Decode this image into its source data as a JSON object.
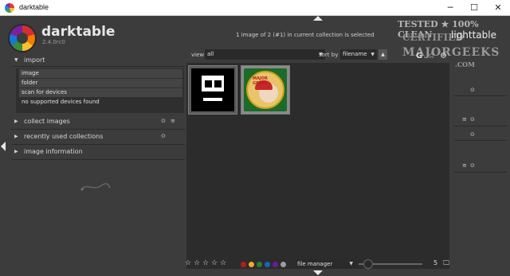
{
  "window": {
    "title": "darktable"
  },
  "header": {
    "app_name": "darktable",
    "version": "2.4.0rc0",
    "status_message": "1 image of 2 (#1) in current collection is selected",
    "view_label": "lighttable",
    "icons": [
      "G",
      "star-icon",
      "gear-icon"
    ]
  },
  "watermark": {
    "line1": "TESTED ★ 100% CLEAN",
    "line2": "CERTIFIED",
    "line3": "MAJORGEEKS",
    "line4": ".COM",
    "stars": "★★★★★"
  },
  "left_panel": {
    "import": {
      "title": "import",
      "items": [
        "image",
        "folder",
        "scan for devices",
        "no supported devices found"
      ]
    },
    "modules": [
      {
        "title": "collect images"
      },
      {
        "title": "recently used collections"
      },
      {
        "title": "image information"
      }
    ]
  },
  "filter_bar": {
    "view_label": "view",
    "view_value": "all",
    "sort_label": "sort by",
    "sort_value": "filename"
  },
  "thumbnails": [
    {
      "name": "skull",
      "selected": false
    },
    {
      "name": "major geeks",
      "text": "MAJOR GEEKS",
      "selected": true
    }
  ],
  "bottom_bar": {
    "rating_stars": 5,
    "color_labels": [
      "#b71c1c",
      "#f9a825",
      "#2e7d32",
      "#1565c0",
      "#6a1b9a",
      "#9e9e9e"
    ],
    "layout_value": "file manager",
    "zoom_value": "5"
  }
}
